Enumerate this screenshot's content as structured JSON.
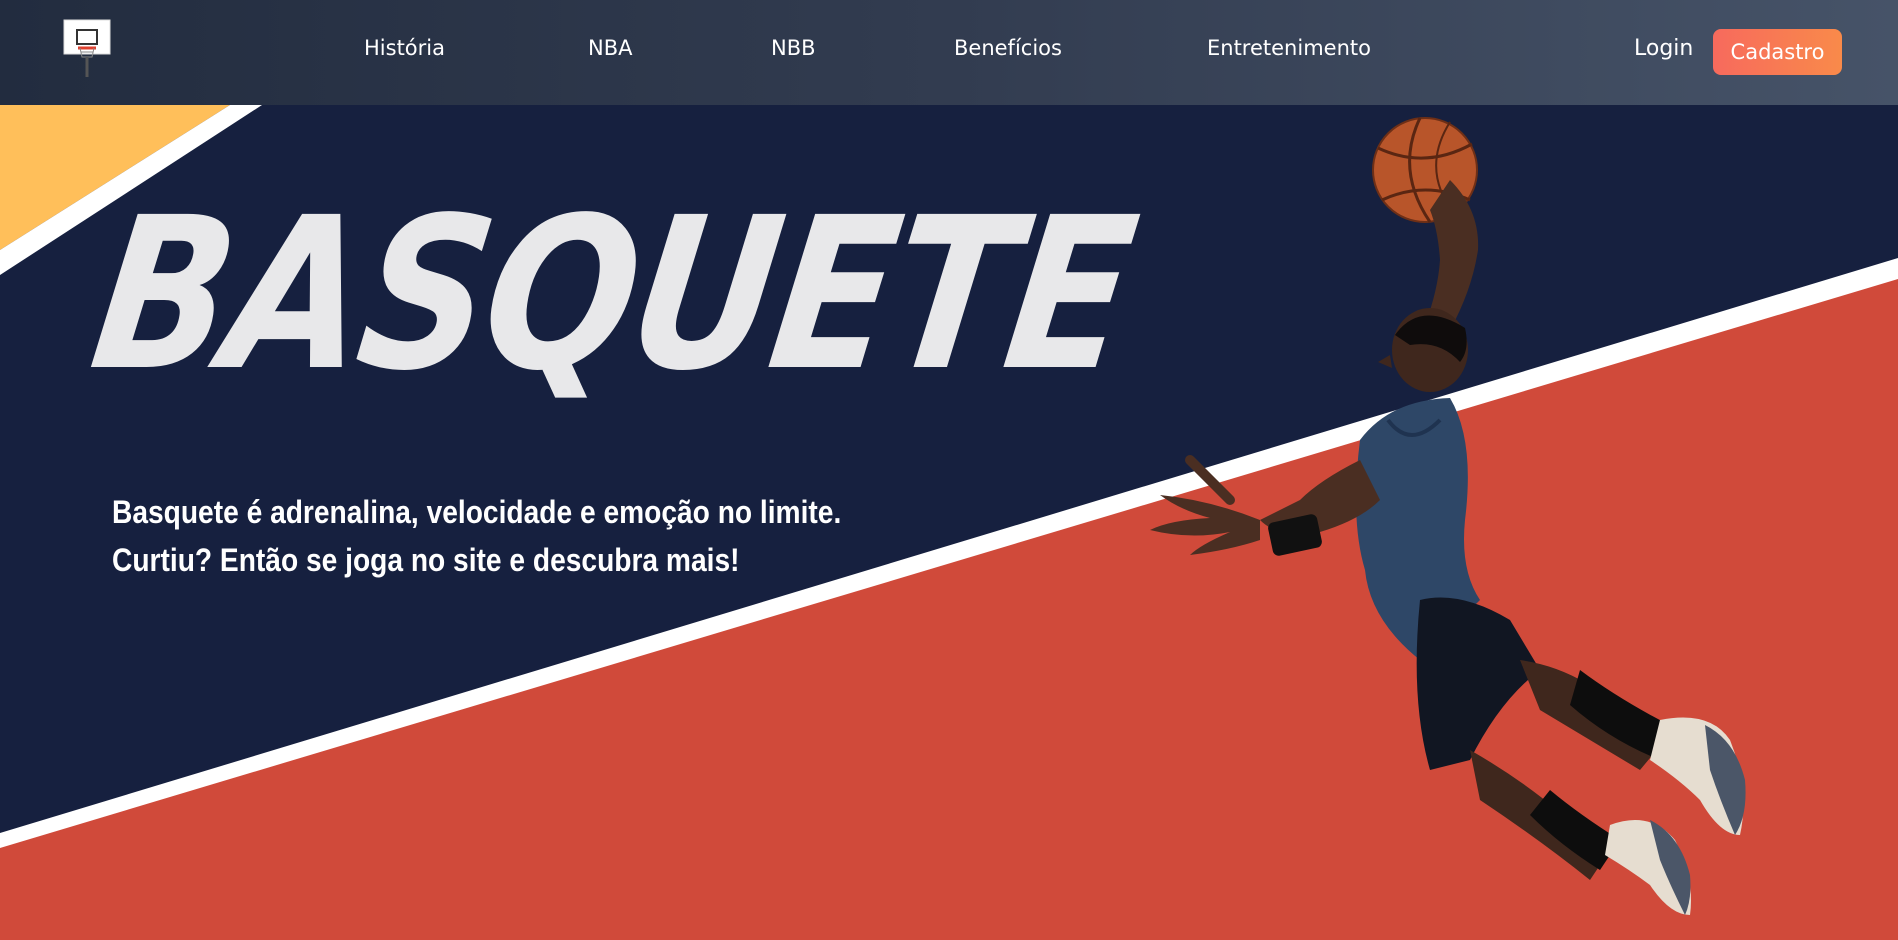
{
  "nav": {
    "items": [
      {
        "label": "História"
      },
      {
        "label": "NBA"
      },
      {
        "label": "NBB"
      },
      {
        "label": "Benefícios"
      },
      {
        "label": "Entretenimento"
      }
    ],
    "login_label": "Login",
    "signup_label": "Cadastro"
  },
  "hero": {
    "title": "BASQUETE",
    "subtitle_line1": "Basquete é adrenalina, velocidade e emoção no limite.",
    "subtitle_line2": "Curtiu? Então se joga no site e descubra mais!"
  },
  "icons": {
    "logo": "basketball-hoop-icon",
    "player": "basketball-player-illustration"
  },
  "colors": {
    "navy": "#16203f",
    "court_red": "#d04a3a",
    "yellow": "#ffbf5a",
    "accent_start": "#f76a5d",
    "accent_end": "#f98a4a"
  }
}
